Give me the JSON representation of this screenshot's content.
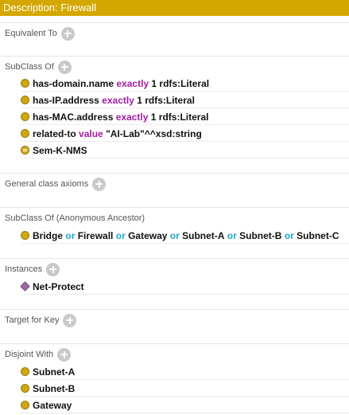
{
  "title": "Description: Firewall",
  "sections": {
    "equivalent": {
      "label": "Equivalent To"
    },
    "subclass": {
      "label": "SubClass Of",
      "rows": [
        {
          "prop": "has-domain.name",
          "kw": "exactly",
          "rest": "1 rdfs:Literal"
        },
        {
          "prop": "has-IP.address",
          "kw": "exactly",
          "rest": "1 rdfs:Literal"
        },
        {
          "prop": "has-MAC.address",
          "kw": "exactly",
          "rest": "1 rdfs:Literal"
        },
        {
          "prop": "related-to",
          "kw": "value",
          "rest": "\"AI-Lab\"^^xsd:string"
        },
        {
          "name": "Sem-K-NMS"
        }
      ]
    },
    "general": {
      "label": "General class axioms"
    },
    "ancestor": {
      "label": "SubClass Of (Anonymous Ancestor)",
      "terms": [
        "Bridge",
        "Firewall",
        "Gateway",
        "Subnet-A",
        "Subnet-B",
        "Subnet-C"
      ],
      "operator": "or"
    },
    "instances": {
      "label": "Instances",
      "items": [
        "Net-Protect"
      ]
    },
    "target": {
      "label": "Target for Key"
    },
    "disjoint": {
      "label": "Disjoint With",
      "items": [
        "Subnet-A",
        "Subnet-B",
        "Gateway"
      ]
    }
  },
  "icons": {
    "add": "add-circle-icon",
    "class": "class-bullet-icon",
    "equivalent": "equivalent-class-icon",
    "individual": "individual-diamond-icon"
  },
  "colors": {
    "title_bg": "#d4a800",
    "keyword": "#a020a0",
    "operator": "#1fa5c5",
    "class_bullet": "#cfa714",
    "individual": "#9b6ba8"
  }
}
